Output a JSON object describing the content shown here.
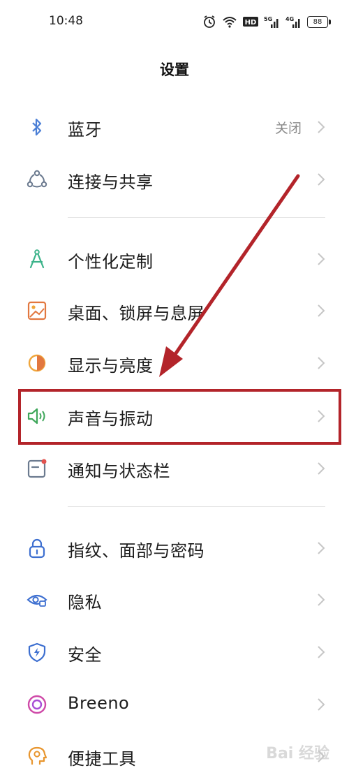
{
  "status_bar": {
    "time": "10:48",
    "network_5g": "5G",
    "network_4g": "4G",
    "hd": "HD",
    "battery": "88"
  },
  "page_title": "设置",
  "items": [
    {
      "label": "蓝牙",
      "value": "关闭",
      "icon": "bluetooth-icon",
      "color": "#4b7fd6"
    },
    {
      "label": "连接与共享",
      "icon": "connection-share-icon",
      "color": "#6b7a8f"
    },
    {
      "label": "个性化定制",
      "icon": "compass-icon",
      "color": "#3cb38a"
    },
    {
      "label": "桌面、锁屏与息屏",
      "icon": "wallpaper-icon",
      "color": "#e2773f"
    },
    {
      "label": "显示与亮度",
      "icon": "brightness-icon",
      "color": "#f0a63b"
    },
    {
      "label": "声音与振动",
      "icon": "speaker-icon",
      "color": "#3fa75b"
    },
    {
      "label": "通知与状态栏",
      "icon": "notification-icon",
      "color": "#e2534f"
    },
    {
      "label": "指纹、面部与密码",
      "icon": "lock-icon",
      "color": "#3d6fd0"
    },
    {
      "label": "隐私",
      "icon": "privacy-eye-icon",
      "color": "#3d6fd0"
    },
    {
      "label": "安全",
      "icon": "security-shield-icon",
      "color": "#3d6fd0"
    },
    {
      "label": "Breeno",
      "icon": "breeno-icon",
      "color": "#cf4aa8"
    },
    {
      "label": "便捷工具",
      "icon": "tools-icon",
      "color": "#e8962f"
    }
  ],
  "watermark": "Bai 经验",
  "annotation_color": "#b3242a"
}
